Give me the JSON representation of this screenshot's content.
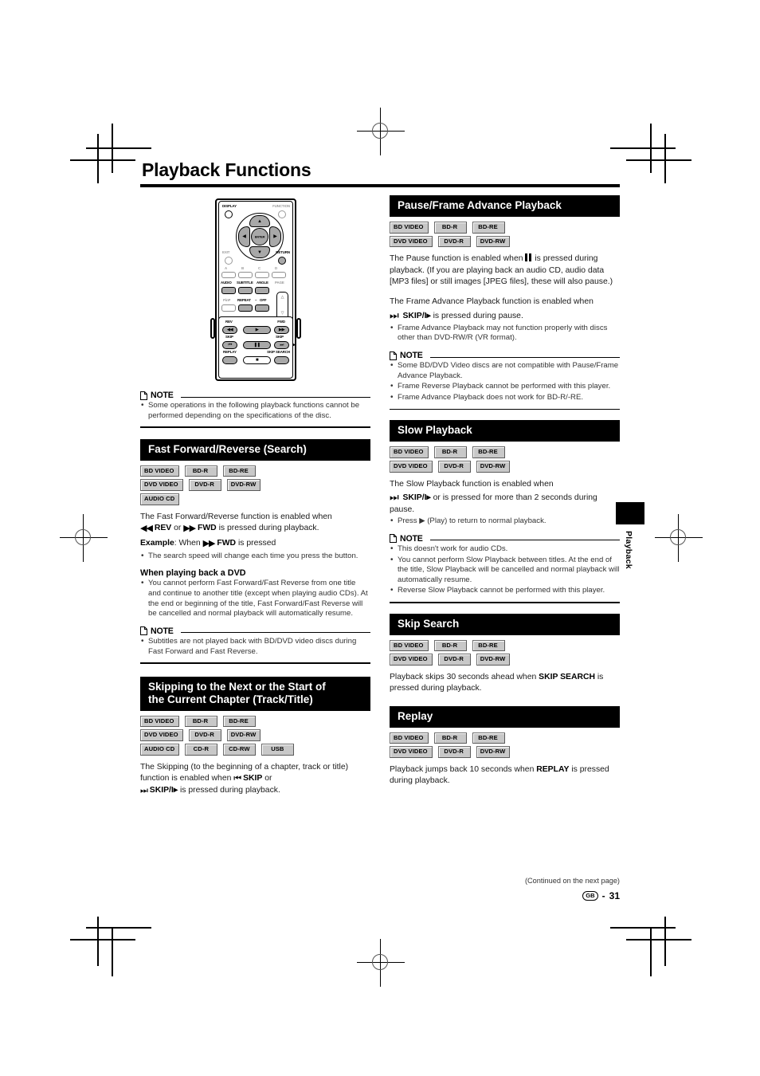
{
  "document": {
    "title": "Playback Functions",
    "page_number": "31",
    "region_code": "GB",
    "continued_note": "(Continued on the next page)",
    "side_tab_label": "Playback"
  },
  "remote": {
    "top_labels": {
      "display": "DISPLAY",
      "function": "FUNCTION",
      "exit": "EXIT",
      "return": "RETURN"
    },
    "color_keys": [
      "A",
      "B",
      "C",
      "D"
    ],
    "func_keys": [
      "AUDIO",
      "SUBTITLE",
      "ANGLE",
      "PAGE"
    ],
    "row3_keys": [
      "PinP",
      "REPEAT",
      "OFF"
    ],
    "repeat_dash": "–",
    "transport": {
      "rev": "REV",
      "fwd": "FWD",
      "skip_left": "SKIP",
      "skip_right": "SKIP",
      "replay": "REPLAY",
      "skip_search": "SKIP SEARCH"
    }
  },
  "left_column": {
    "intro_note": {
      "label": "NOTE",
      "items": [
        "Some operations in the following playback functions cannot be performed depending on the specifications of the disc."
      ]
    },
    "fast_forward": {
      "heading": "Fast Forward/Reverse (Search)",
      "badges": [
        [
          "BD VIDEO",
          "BD-R",
          "BD-RE"
        ],
        [
          "DVD VIDEO",
          "DVD-R",
          "DVD-RW"
        ],
        [
          "AUDIO CD"
        ]
      ],
      "para_1a": "The Fast Forward/Reverse function is enabled when",
      "rev_label": "REV",
      "or_text": "or",
      "fwd_label": "FWD",
      "para_1b": "is pressed during playback.",
      "example_label": "Example",
      "example_mid": ": When",
      "example_fwd": "FWD",
      "example_end": "is pressed",
      "bullets_1": [
        "The search speed will change each time you press the button."
      ],
      "sub_heading": "When playing back a DVD",
      "bullets_2": [
        "You cannot perform Fast Forward/Fast Reverse from one title and continue to another title (except when playing audio CDs). At the end or beginning of the title, Fast Forward/Fast Reverse will be cancelled and normal playback will automatically resume."
      ],
      "note": {
        "label": "NOTE",
        "items": [
          "Subtitles are not played back with BD/DVD video discs during Fast Forward and Fast Reverse."
        ]
      }
    },
    "skipping": {
      "heading_line1": "Skipping to the Next or the Start of",
      "heading_line2": "the Current Chapter (Track/Title)",
      "badges": [
        [
          "BD VIDEO",
          "BD-R",
          "BD-RE"
        ],
        [
          "DVD VIDEO",
          "DVD-R",
          "DVD-RW"
        ],
        [
          "AUDIO CD",
          "CD-R",
          "CD-RW",
          "USB"
        ]
      ],
      "para_a": "The Skipping (to the beginning of a chapter, track or title) function is enabled when",
      "skip_label": "SKIP",
      "or_text": "or",
      "skip_slash_label": "SKIP/I▸",
      "para_b": "is pressed during playback."
    }
  },
  "right_column": {
    "pause_frame": {
      "heading": "Pause/Frame Advance Playback",
      "badges": [
        [
          "BD VIDEO",
          "BD-R",
          "BD-RE"
        ],
        [
          "DVD VIDEO",
          "DVD-R",
          "DVD-RW"
        ]
      ],
      "para_1a": "The Pause function is enabled when",
      "para_1b": "is pressed during playback. (If you are playing back an audio CD, audio data [MP3 files] or still images [JPEG files], these will also pause.)",
      "para_2a": "The Frame Advance Playback function is enabled when",
      "skip_label": "SKIP/I▸",
      "para_2b": "is pressed during pause.",
      "bullets": [
        "Frame Advance Playback may not function properly with discs other than DVD-RW/R (VR format)."
      ],
      "note": {
        "label": "NOTE",
        "items": [
          "Some BD/DVD Video discs are not compatible with Pause/Frame Advance Playback.",
          "Frame Reverse Playback cannot be performed with this player.",
          "Frame Advance Playback does not work for BD-R/-RE."
        ]
      }
    },
    "slow_playback": {
      "heading": "Slow Playback",
      "badges": [
        [
          "BD VIDEO",
          "BD-R",
          "BD-RE"
        ],
        [
          "DVD VIDEO",
          "DVD-R",
          "DVD-RW"
        ]
      ],
      "para_a": "The Slow Playback function is enabled when",
      "skip_label": "SKIP/I▸",
      "para_b": "or is pressed for more than 2 seconds during pause.",
      "bullets": [
        "Press ▶ (Play) to return to normal playback."
      ],
      "note": {
        "label": "NOTE",
        "items": [
          "This doesn't work for audio CDs.",
          "You cannot perform Slow Playback between titles. At the end of the title, Slow Playback will be cancelled and normal playback will automatically resume.",
          "Reverse Slow Playback cannot be performed with this player."
        ]
      }
    },
    "skip_search": {
      "heading": "Skip Search",
      "badges": [
        [
          "BD VIDEO",
          "BD-R",
          "BD-RE"
        ],
        [
          "DVD VIDEO",
          "DVD-R",
          "DVD-RW"
        ]
      ],
      "para_a": "Playback skips 30 seconds ahead when",
      "key_label": "SKIP SEARCH",
      "para_b": "is pressed during playback."
    },
    "replay": {
      "heading": "Replay",
      "badges": [
        [
          "BD VIDEO",
          "BD-R",
          "BD-RE"
        ],
        [
          "DVD VIDEO",
          "DVD-R",
          "DVD-RW"
        ]
      ],
      "para_a": "Playback jumps back 10 seconds when",
      "key_label": "REPLAY",
      "para_b": "is pressed during playback."
    }
  }
}
